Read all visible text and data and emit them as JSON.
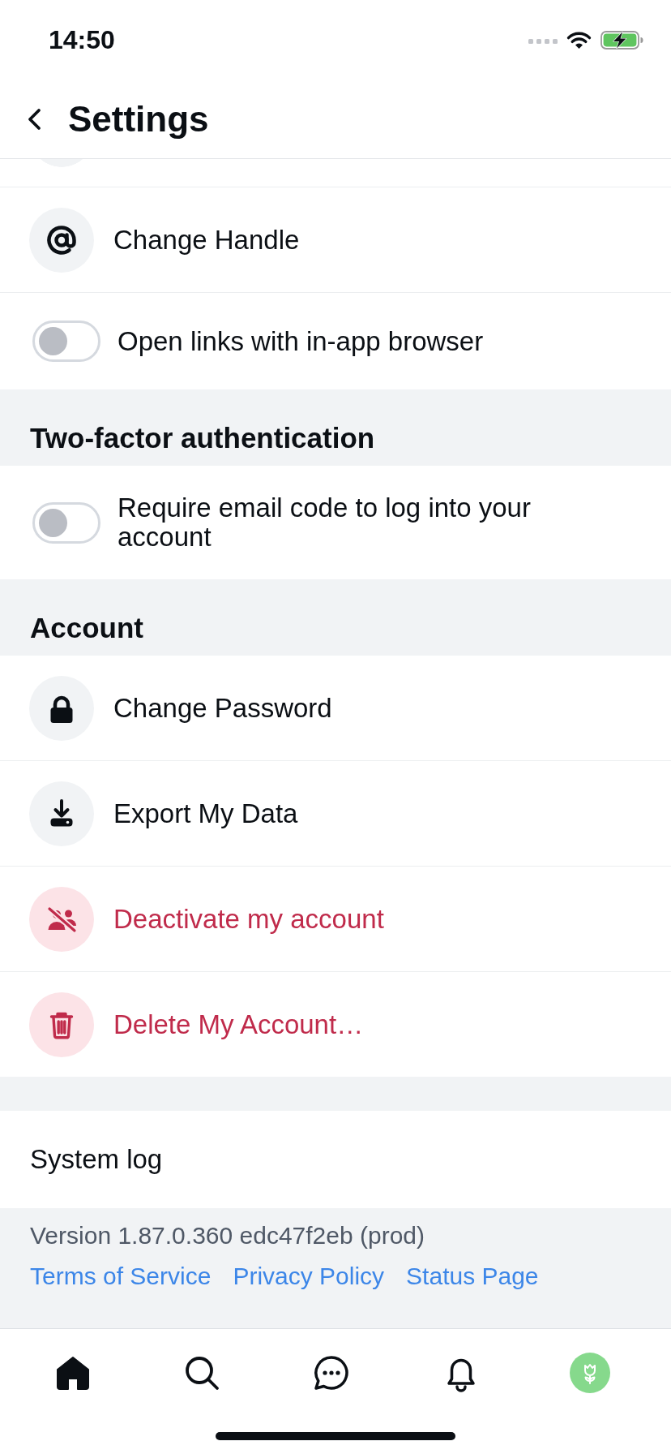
{
  "status_bar": {
    "time": "14:50"
  },
  "header": {
    "title": "Settings"
  },
  "sections": [
    {
      "items": [
        {
          "kind": "clipped"
        },
        {
          "kind": "link",
          "label": "Change Handle",
          "destructive": false
        },
        {
          "kind": "toggle",
          "label": "Open links with in-app browser",
          "on": false
        }
      ]
    },
    {
      "heading": "Two-factor authentication",
      "items": [
        {
          "kind": "toggle",
          "label": "Require email code to log into your account",
          "on": false
        }
      ]
    },
    {
      "heading": "Account",
      "items": [
        {
          "kind": "link",
          "label": "Change Password",
          "destructive": false
        },
        {
          "kind": "link",
          "label": "Export My Data",
          "destructive": false
        },
        {
          "kind": "link",
          "label": "Deactivate my account",
          "destructive": true
        },
        {
          "kind": "link",
          "label": "Delete My Account…",
          "destructive": true
        }
      ]
    },
    {
      "items": [
        {
          "kind": "plain",
          "label": "System log"
        }
      ]
    }
  ],
  "footer": {
    "version": "Version 1.87.0.360 edc47f2eb (prod)",
    "links": [
      "Terms of Service",
      "Privacy Policy",
      "Status Page"
    ]
  },
  "tab_bar": {
    "tabs": [
      {
        "selected": true
      },
      {
        "selected": false
      },
      {
        "selected": false
      },
      {
        "selected": false
      },
      {
        "selected": false
      }
    ]
  }
}
